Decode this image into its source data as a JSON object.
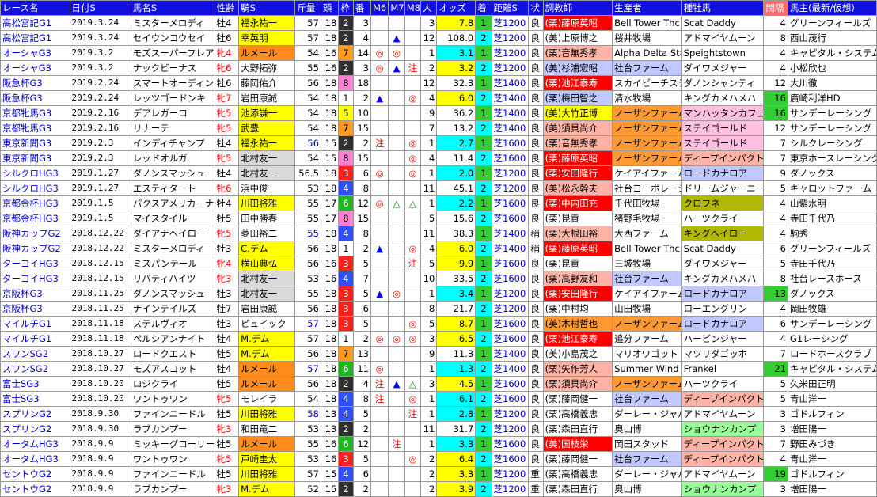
{
  "headers": [
    "レース名",
    "日付S",
    "馬名S",
    "性齢",
    "騎S",
    "斤量",
    "頭",
    "枠",
    "番",
    "M6",
    "M7",
    "M8",
    "人",
    "オッズ",
    "着",
    "距離S",
    "状",
    "調教師",
    "生産者",
    "種牡馬",
    "間隔",
    "馬主(最新/仮想)"
  ],
  "rows": [
    [
      "高松宮記G1",
      "2019.3.24",
      "ミスターメロディ",
      "牡4",
      "福永祐一",
      "57",
      "18",
      "2",
      "3",
      "",
      "",
      "",
      "3",
      "7.8",
      "1",
      "芝1200",
      "良",
      "(栗)藤原英昭",
      "Bell Tower Thc",
      "Scat Daddy",
      "4",
      "グリーンフィールズ"
    ],
    [
      "高松宮記G1",
      "2019.3.24",
      "セイウンコウセイ",
      "牡6",
      "幸英明",
      "57",
      "18",
      "2",
      "4",
      "",
      "▲",
      "",
      "12",
      "108.0",
      "2",
      "芝1200",
      "良",
      "(美)上原博之",
      "桜井牧場",
      "アドマイヤムーン",
      "8",
      "西山茂行"
    ],
    [
      "オーシャG3",
      "2019.3.2",
      "モズスーパーフレア",
      "牝4",
      "ルメール",
      "54",
      "16",
      "7",
      "14",
      "◎",
      "◎",
      "",
      "1",
      "3.1",
      "1",
      "芝1200",
      "良",
      "(栗)音無秀孝",
      "Alpha Delta Sta",
      "Speightstown",
      "4",
      "キャピタル・システム"
    ],
    [
      "オーシャG3",
      "2019.3.2",
      "ナックビーナス",
      "牝6",
      "大野拓弥",
      "55",
      "16",
      "2",
      "3",
      "◎",
      "▲",
      "注",
      "2",
      "3.2",
      "2",
      "芝1200",
      "良",
      "(美)杉浦宏昭",
      "社台ファーム",
      "ダイワメジャー",
      "4",
      "小松欣也"
    ],
    [
      "阪急杯G3",
      "2019.2.24",
      "スマートオーディン",
      "牡6",
      "藤岡佑介",
      "56",
      "18",
      "8",
      "18",
      "",
      "",
      "",
      "12",
      "32.3",
      "1",
      "芝1400",
      "良",
      "(栗)池江泰寿",
      "スカイビーチステーブ",
      "ダノンシャンティ",
      "12",
      "大川徹"
    ],
    [
      "阪急杯G3",
      "2019.2.24",
      "レッツゴードンキ",
      "牝7",
      "岩田康誠",
      "54",
      "18",
      "1",
      "2",
      "▲",
      "",
      "◎",
      "4",
      "6.0",
      "2",
      "芝1400",
      "良",
      "(栗)梅田智之",
      "清水牧場",
      "キングカメハメハ",
      "16",
      "廣崎利洋HD"
    ],
    [
      "京都牝馬G3",
      "2019.2.16",
      "デアレガーロ",
      "牝5",
      "池添謙一",
      "54",
      "18",
      "5",
      "10",
      "",
      "",
      "",
      "9",
      "36.2",
      "1",
      "芝1400",
      "良",
      "(美)大竹正博",
      "ノーザンファーム",
      "マンハッタンカフェ",
      "16",
      "サンデーレーシング"
    ],
    [
      "京都牝馬G3",
      "2019.2.16",
      "リナーテ",
      "牝5",
      "武豊",
      "54",
      "18",
      "7",
      "15",
      "",
      "",
      "",
      "7",
      "13.2",
      "2",
      "芝1400",
      "良",
      "(美)須貝尚介",
      "ノーザンファーム",
      "ステイゴールド",
      "12",
      "サンデーレーシング"
    ],
    [
      "東京新聞G3",
      "2019.2.3",
      "インディチャンプ",
      "牡4",
      "福永祐一",
      "56",
      "15",
      "2",
      "2",
      "注",
      "",
      "◎",
      "1",
      "2.7",
      "1",
      "芝1600",
      "良",
      "(栗)音無秀孝",
      "ノーザンファーム",
      "ステイゴールド",
      "7",
      "シルクレーシング"
    ],
    [
      "東京新聞G3",
      "2019.2.3",
      "レッドオルガ",
      "牝5",
      "北村友一",
      "54",
      "15",
      "8",
      "15",
      "",
      "",
      "◎",
      "4",
      "11.4",
      "2",
      "芝1600",
      "良",
      "(栗)藤原英昭",
      "ノーザンファーム",
      "ディープインパクト",
      "7",
      "東京ホースレーシング"
    ],
    [
      "シルクロHG3",
      "2019.1.27",
      "ダノンスマッシュ",
      "牡4",
      "北村友一",
      "56.5",
      "18",
      "3",
      "6",
      "◎",
      "",
      "◎",
      "1",
      "2.0",
      "1",
      "芝1200",
      "良",
      "(栗)安田隆行",
      "ケイアイファーム",
      "ロードカナロア",
      "9",
      "ダノックス"
    ],
    [
      "シルクロHG3",
      "2019.1.27",
      "エスティタート",
      "牝6",
      "浜中俊",
      "53",
      "18",
      "4",
      "8",
      "",
      "",
      "",
      "11",
      "45.1",
      "2",
      "芝1200",
      "良",
      "(美)松永幹夫",
      "社台コーポレーション",
      "ドリームジャーニー",
      "5",
      "キャロットファーム"
    ],
    [
      "京都金杯HG3",
      "2019.1.5",
      "パクスアメリカーナ",
      "牡4",
      "川田将雅",
      "55",
      "17",
      "6",
      "12",
      "◎",
      "△",
      "△",
      "1",
      "2.2",
      "1",
      "芝1600",
      "良",
      "(栗)中内田充",
      "千代田牧場",
      "クロフネ",
      "4",
      "山紫水明"
    ],
    [
      "京都金杯HG3",
      "2019.1.5",
      "マイスタイル",
      "牡5",
      "田中勝春",
      "55",
      "17",
      "8",
      "15",
      "",
      "",
      "",
      "5",
      "15.6",
      "2",
      "芝1600",
      "良",
      "(栗)昆貢",
      "猪野毛牧場",
      "ハーツクライ",
      "4",
      "寺田千代乃"
    ],
    [
      "阪神カップG2",
      "2018.12.22",
      "ダイアナヘイロー",
      "牝5",
      "菱田裕二",
      "55",
      "18",
      "4",
      "8",
      "",
      "",
      "",
      "11",
      "38.3",
      "1",
      "芝1400",
      "稍",
      "(栗)大根田裕",
      "大西ファーム",
      "キングへイロー",
      "4",
      "駒秀"
    ],
    [
      "阪神カップG2",
      "2018.12.22",
      "ミスターメロディ",
      "牡3",
      "C.デム",
      "56",
      "18",
      "1",
      "2",
      "▲",
      "",
      "◎",
      "4",
      "6.0",
      "2",
      "芝1400",
      "稍",
      "(栗)藤原英昭",
      "Bell Tower Thc",
      "Scat Daddy",
      "6",
      "グリーンフィールズ"
    ],
    [
      "ターコイHG3",
      "2018.12.15",
      "ミスパンテール",
      "牝4",
      "横山典弘",
      "56",
      "16",
      "3",
      "5",
      "",
      "",
      "注",
      "5",
      "9.9",
      "1",
      "芝1600",
      "良",
      "(栗)昆貢",
      "三城牧場",
      "ダイワメジャー",
      "5",
      "寺田千代乃"
    ],
    [
      "ターコイHG3",
      "2018.12.15",
      "リバティハイツ",
      "牝3",
      "北村友一",
      "53",
      "16",
      "4",
      "7",
      "",
      "",
      "",
      "10",
      "33.5",
      "2",
      "芝1600",
      "良",
      "(栗)高野友和",
      "社台ファーム",
      "キングカメハメハ",
      "8",
      "社台レースホース"
    ],
    [
      "京阪杯G3",
      "2018.11.25",
      "ダノンスマッシュ",
      "牡3",
      "北村友一",
      "55",
      "18",
      "3",
      "5",
      "▲",
      "◎",
      "",
      "1",
      "3.4",
      "1",
      "芝1200",
      "良",
      "(栗)安田隆行",
      "ケイアイファーム",
      "ロードカナロア",
      "13",
      "ダノックス"
    ],
    [
      "京阪杯G3",
      "2018.11.25",
      "ナインテイルズ",
      "牡7",
      "岩田康誠",
      "56",
      "18",
      "3",
      "6",
      "",
      "",
      "",
      "8",
      "21.7",
      "2",
      "芝1200",
      "良",
      "(栗)中村均",
      "山田牧場",
      "ローエングリン",
      "4",
      "岡田牧雄"
    ],
    [
      "マイルチG1",
      "2018.11.18",
      "ステルヴィオ",
      "牡3",
      "ビュイック",
      "57",
      "18",
      "3",
      "5",
      "",
      "",
      "◎",
      "5",
      "8.7",
      "1",
      "芝1600",
      "良",
      "(美)木村哲也",
      "ノーザンファーム",
      "ロードカナロア",
      "6",
      "サンデーレーシング"
    ],
    [
      "マイルチG1",
      "2018.11.18",
      "ペルシアンナイト",
      "牡4",
      "M.デム",
      "57",
      "18",
      "1",
      "2",
      "◎",
      "◎",
      "◎",
      "3",
      "6.5",
      "2",
      "芝1600",
      "良",
      "(栗)池江泰寿",
      "追分ファーム",
      "ハービンジャー",
      "4",
      "G1レーシング"
    ],
    [
      "スワンSG2",
      "2018.10.27",
      "ロードクエスト",
      "牡5",
      "M.デム",
      "56",
      "18",
      "7",
      "13",
      "",
      "",
      "",
      "9",
      "11.3",
      "1",
      "芝1400",
      "良",
      "(美)小島茂之",
      "マリオワゴット",
      "マツリダゴッホ",
      "7",
      "ロードホースクラブ"
    ],
    [
      "スワンSG2",
      "2018.10.27",
      "モズアスコット",
      "牡4",
      "ルメール",
      "57",
      "18",
      "6",
      "11",
      "◎",
      "",
      "",
      "1",
      "1.3",
      "2",
      "芝1400",
      "良",
      "(栗)矢作芳人",
      "Summer Wind F",
      "Frankel",
      "21",
      "キャピタル・システム"
    ],
    [
      "富士SG3",
      "2018.10.20",
      "ロジクライ",
      "牡5",
      "ルメール",
      "56",
      "18",
      "2",
      "4",
      "注",
      "▲",
      "△",
      "3",
      "4.5",
      "1",
      "芝1600",
      "良",
      "(栗)須貝尚介",
      "ノーザンファーム",
      "ハーツクライ",
      "5",
      "久米田正明"
    ],
    [
      "富士SG3",
      "2018.10.20",
      "ワントゥワン",
      "牝5",
      "モレイラ",
      "54",
      "18",
      "4",
      "8",
      "注",
      "",
      "◎",
      "1",
      "6.1",
      "2",
      "芝1600",
      "良",
      "(栗)藤岡健一",
      "社台ファーム",
      "ディープインパクト",
      "5",
      "青山洋一"
    ],
    [
      "スプリンG2",
      "2018.9.30",
      "ファインニードル",
      "牡5",
      "川田将雅",
      "58",
      "13",
      "4",
      "5",
      "",
      "",
      "注",
      "1",
      "2.8",
      "1",
      "芝1200",
      "良",
      "(栗)高橋義忠",
      "ダーレー・ジャパン",
      "アドマイヤムーン",
      "3",
      "ゴドルフィン"
    ],
    [
      "スプリンG2",
      "2018.9.30",
      "ラブカンプー",
      "牝3",
      "和田竜二",
      "53",
      "13",
      "2",
      "2",
      "",
      "",
      "",
      "11",
      "31.7",
      "2",
      "芝1200",
      "良",
      "(栗)森田直行",
      "奥山博",
      "ショウナンカンプ",
      "3",
      "増田陽一"
    ],
    [
      "オータムHG3",
      "2018.9.9",
      "ミッキーグローリー",
      "牡5",
      "ルメール",
      "55",
      "16",
      "6",
      "12",
      "",
      "注",
      "",
      "1",
      "3.3",
      "1",
      "芝1600",
      "良",
      "(美)国枝栄",
      "岡田スタッド",
      "ディープインパクト",
      "7",
      "野田みづき"
    ],
    [
      "オータムHG3",
      "2018.9.9",
      "ワントゥワン",
      "牝5",
      "戸崎圭太",
      "53",
      "16",
      "3",
      "5",
      "",
      "",
      "◎",
      "2",
      "6.4",
      "2",
      "芝1600",
      "良",
      "(栗)藤岡健一",
      "社台ファーム",
      "ディープインパクト",
      "4",
      "青山洋一"
    ],
    [
      "セントウG2",
      "2018.9.9",
      "ファインニードル",
      "牡5",
      "川田将雅",
      "57",
      "15",
      "4",
      "6",
      "",
      "",
      "",
      "2",
      "3.3",
      "1",
      "芝1200",
      "重",
      "(栗)高橋義忠",
      "ダーレー・ジャパン",
      "アドマイヤムーン",
      "19",
      "ゴドルフィン"
    ],
    [
      "セントウG2",
      "2018.9.9",
      "ラブカンプー",
      "牝3",
      "M.デム",
      "52",
      "15",
      "2",
      "2",
      "",
      "",
      "",
      "2",
      "3.9",
      "2",
      "芝1200",
      "重",
      "(栗)森田直行",
      "奥山博",
      "ショウナンカンプ",
      "3",
      "増田陽一"
    ]
  ]
}
